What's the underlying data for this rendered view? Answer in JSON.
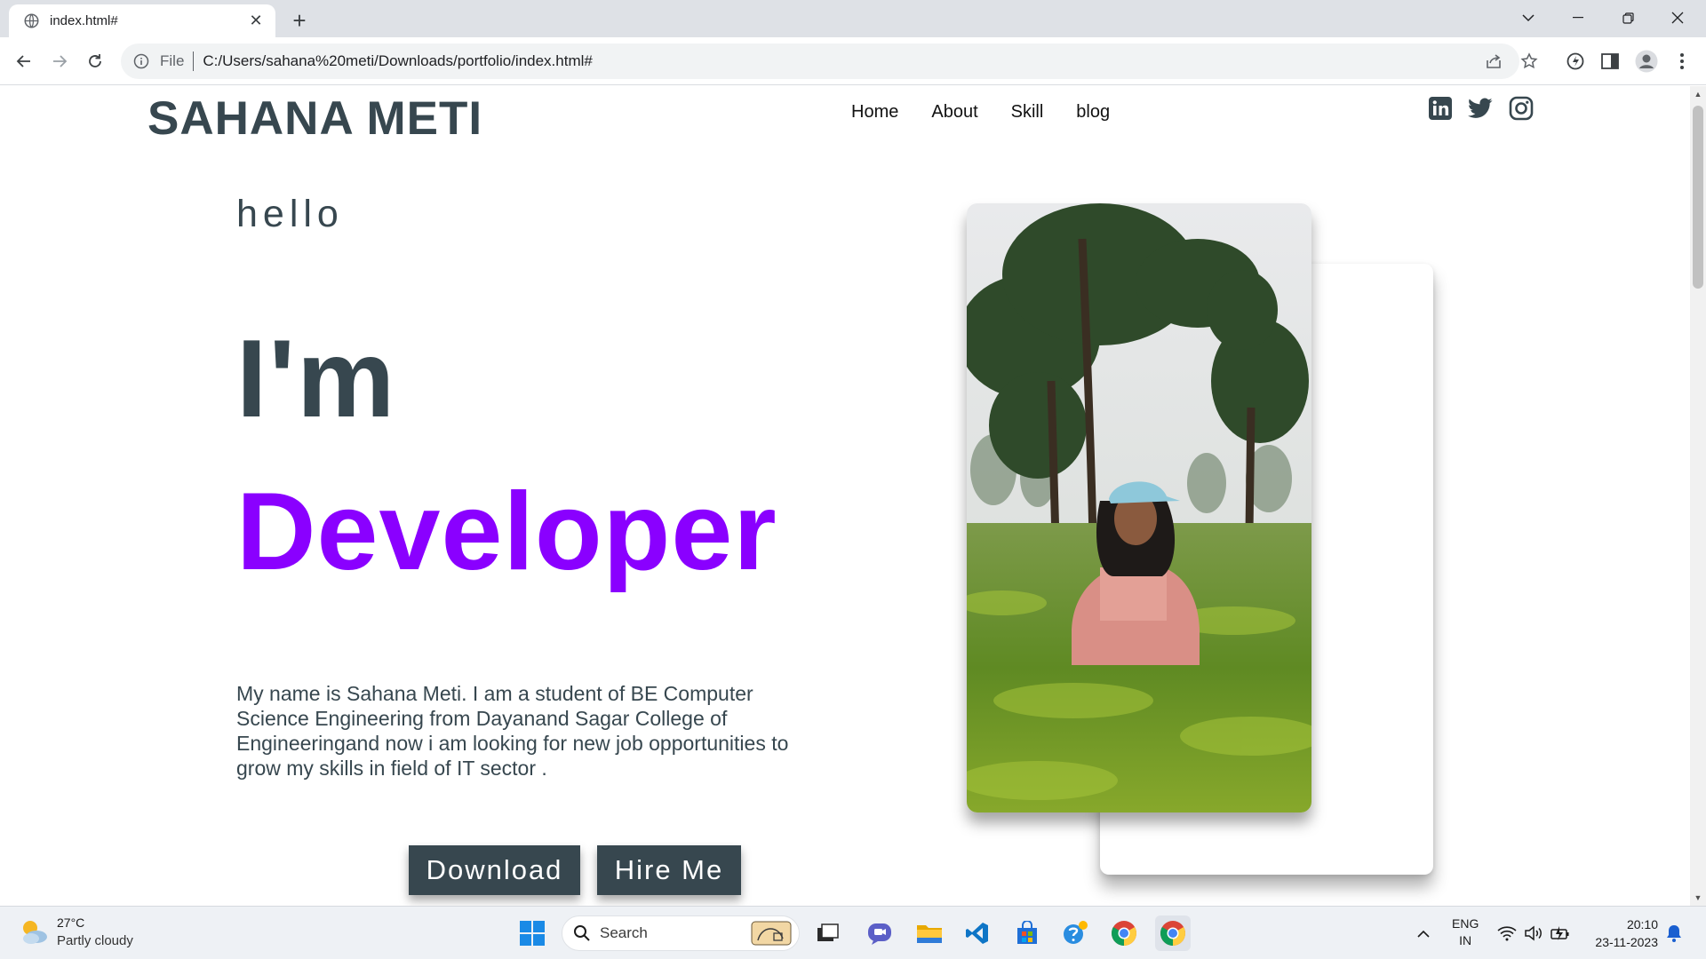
{
  "browser": {
    "tab_title": "index.html#",
    "url_scheme": "File",
    "url": "C:/Users/sahana%20meti/Downloads/portfolio/index.html#"
  },
  "site": {
    "brand": "SAHANA METI",
    "nav": [
      "Home",
      "About",
      "Skill",
      "blog"
    ],
    "social_icons": [
      "linkedin-icon",
      "twitter-icon",
      "instagram-icon"
    ]
  },
  "hero": {
    "greeting": "hello",
    "intro": "I'm",
    "role": "Developer",
    "bio": "My name is Sahana Meti. I am a student of BE Computer Science Engineering from Dayanand Sagar College of Engineeringand now i am looking for new job opportunities to grow my skills in field of IT sector .",
    "download_label": "Download",
    "hire_label": "Hire Me",
    "role_color": "#8a00ff",
    "text_color": "#37474f"
  },
  "taskbar": {
    "temperature": "27°C",
    "condition": "Partly cloudy",
    "search_placeholder": "Search",
    "lang_line1": "ENG",
    "lang_line2": "IN",
    "time": "20:10",
    "date": "23-11-2023"
  }
}
